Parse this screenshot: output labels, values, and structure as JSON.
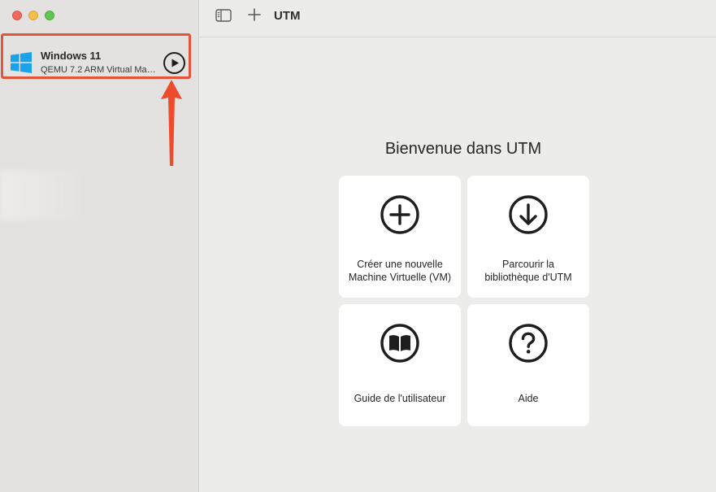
{
  "window": {
    "title": "UTM"
  },
  "sidebar": {
    "vm": {
      "name": "Windows 11",
      "subtitle": "QEMU 7.2 ARM Virtual Machine",
      "icon": "windows-logo-icon",
      "action_icon": "play-icon"
    }
  },
  "toolbar": {
    "title": "UTM",
    "sidebar_toggle_icon": "sidebar-toggle-icon",
    "add_icon": "plus-icon"
  },
  "main": {
    "welcome": "Bienvenue dans UTM",
    "cards": [
      {
        "line1": "Créer une nouvelle",
        "line2": "Machine Virtuelle (VM)",
        "icon": "plus-circle-icon"
      },
      {
        "line1": "Parcourir la",
        "line2": "bibliothèque d'UTM",
        "icon": "download-circle-icon"
      },
      {
        "line1": "Guide de l'utilisateur",
        "icon": "book-icon"
      },
      {
        "line1": "Aide",
        "icon": "question-circle-icon"
      }
    ]
  },
  "colors": {
    "highlight": "#e5533b",
    "windows_blue": "#1aa3e8"
  }
}
